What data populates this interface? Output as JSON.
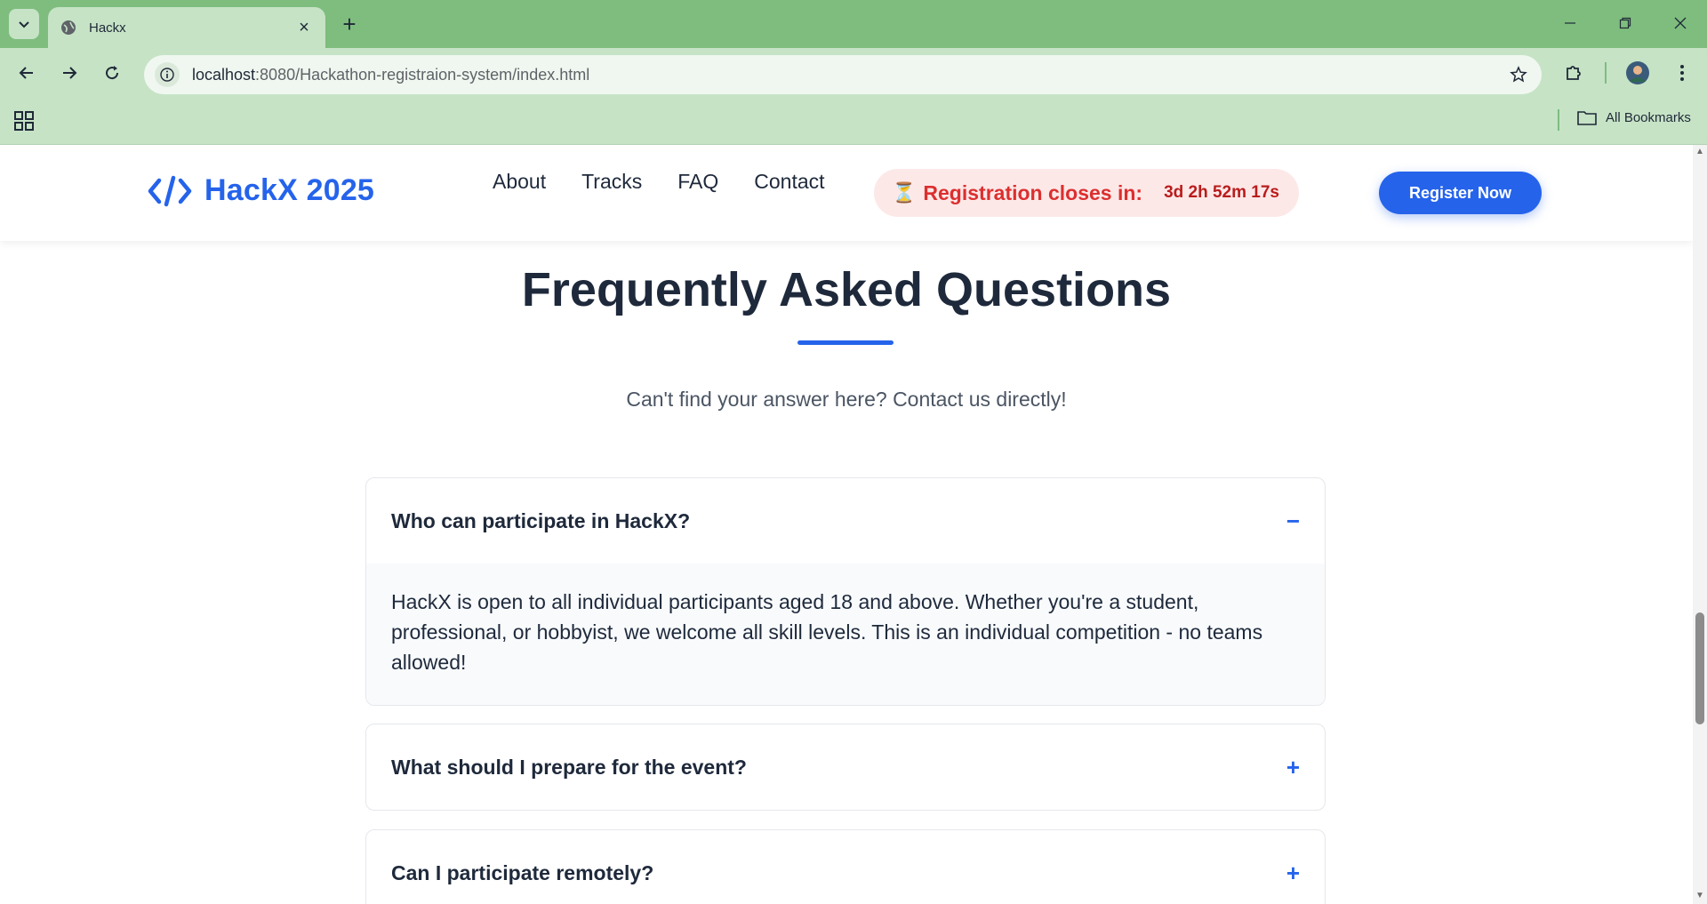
{
  "browser": {
    "tab_title": "Hackx",
    "url_host": "localhost",
    "url_path": ":8080/Hackathon-registraion-system/index.html",
    "bookmarks_label": "All Bookmarks"
  },
  "header": {
    "logo_text": "HackX 2025",
    "nav": [
      "About",
      "Tracks",
      "FAQ",
      "Contact"
    ],
    "countdown_icon": "⏳",
    "countdown_label": "Registration closes in:",
    "countdown_time": "3d 2h 52m 17s",
    "register_label": "Register Now"
  },
  "faq": {
    "title": "Frequently Asked Questions",
    "subtitle": "Can't find your answer here? Contact us directly!",
    "items": [
      {
        "question": "Who can participate in HackX?",
        "toggle": "−",
        "expanded": true,
        "answer": "HackX is open to all individual participants aged 18 and above. Whether you're a student, professional, or hobbyist, we welcome all skill levels. This is an individual competition - no teams allowed!"
      },
      {
        "question": "What should I prepare for the event?",
        "toggle": "+",
        "expanded": false
      },
      {
        "question": "Can I participate remotely?",
        "toggle": "+",
        "expanded": false
      }
    ]
  },
  "colors": {
    "brand": "#2563eb",
    "countdown_text": "#dc2f2f",
    "countdown_bg": "#fde8e8",
    "browser_frame": "#7ebd7e"
  }
}
